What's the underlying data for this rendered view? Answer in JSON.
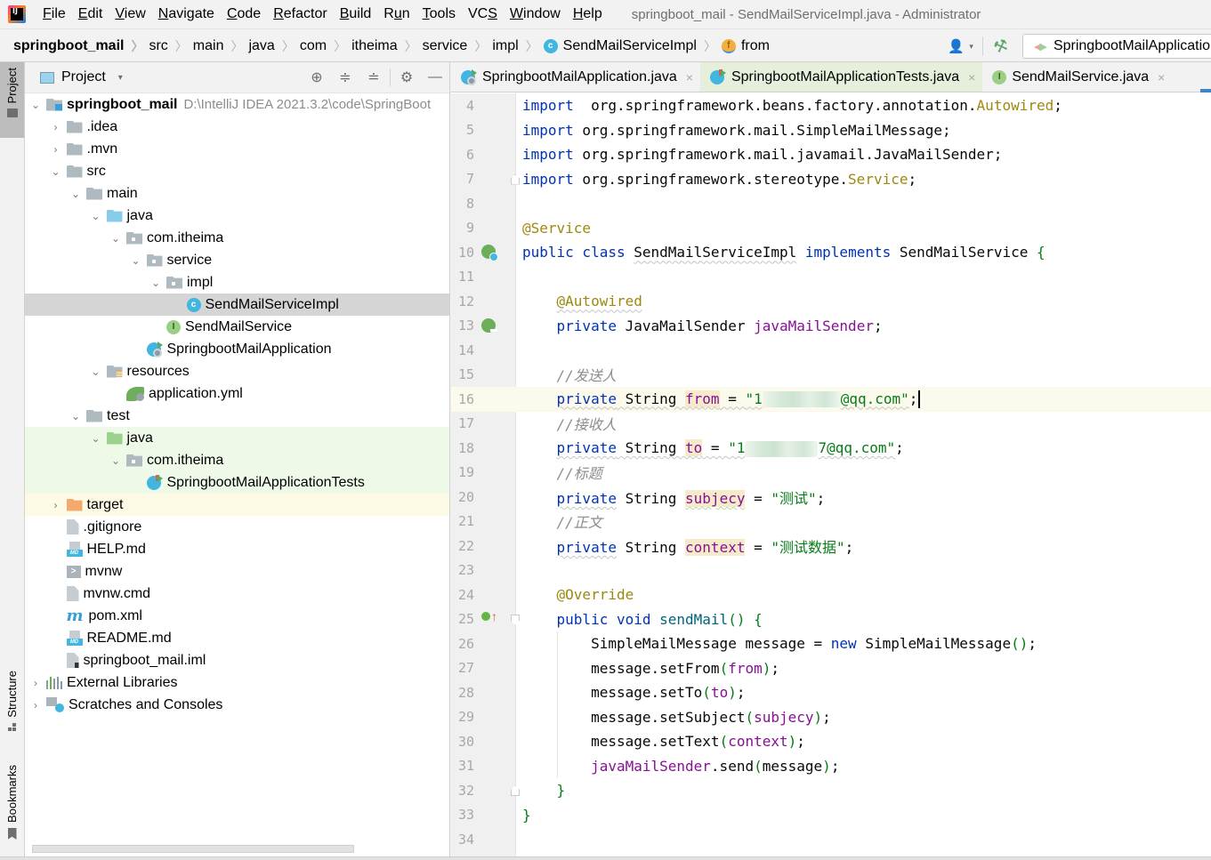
{
  "menubar": {
    "logo_text": "IJ",
    "items": [
      {
        "label": "File",
        "mnemonic": "F",
        "rest": "ile"
      },
      {
        "label": "Edit",
        "mnemonic": "E",
        "rest": "dit"
      },
      {
        "label": "View",
        "mnemonic": "V",
        "rest": "iew"
      },
      {
        "label": "Navigate",
        "mnemonic": "N",
        "rest": "avigate"
      },
      {
        "label": "Code",
        "mnemonic": "C",
        "rest": "ode"
      },
      {
        "label": "Refactor",
        "mnemonic": "R",
        "rest": "efactor"
      },
      {
        "label": "Build",
        "mnemonic": "B",
        "rest": "uild"
      },
      {
        "label": "Run",
        "pre": "R",
        "mnemonic": "u",
        "rest": "n"
      },
      {
        "label": "Tools",
        "mnemonic": "T",
        "rest": "ools"
      },
      {
        "label": "VCS",
        "pre": "VC",
        "mnemonic": "S",
        "rest": ""
      },
      {
        "label": "Window",
        "mnemonic": "W",
        "rest": "indow"
      },
      {
        "label": "Help",
        "mnemonic": "H",
        "rest": "elp"
      }
    ],
    "window_title": "springboot_mail - SendMailServiceImpl.java - Administrator"
  },
  "breadcrumb": {
    "items": [
      "springboot_mail",
      "src",
      "main",
      "java",
      "com",
      "itheima",
      "service",
      "impl",
      "SendMailServiceImpl",
      "from"
    ],
    "class_icon_glyph": "c",
    "field_icon_glyph": "f",
    "separator": "〉"
  },
  "navbar": {
    "vcs_user_icon": "👤",
    "caret": "▾",
    "build_icon": "⚒",
    "run_config_label": "SpringbootMailApplication"
  },
  "toolstrip": {
    "project_label": "Project",
    "structure_label": "Structure",
    "bookmarks_label": "Bookmarks"
  },
  "project_panel": {
    "title": "Project",
    "caret": "▾",
    "tools": {
      "locate": "⊕",
      "expand_all": "≑",
      "collapse_all": "≐",
      "settings": "⚙",
      "hide": "—"
    },
    "tree": [
      {
        "label": "springboot_mail",
        "path": "D:\\IntelliJ IDEA 2021.3.2\\code\\SpringBoot",
        "twisty": "⌄",
        "depth": 0,
        "icon": "module",
        "bold": true
      },
      {
        "label": ".idea",
        "twisty": "›",
        "depth": 1,
        "icon": "folder"
      },
      {
        "label": ".mvn",
        "twisty": "›",
        "depth": 1,
        "icon": "folder"
      },
      {
        "label": "src",
        "twisty": "⌄",
        "depth": 1,
        "icon": "folder"
      },
      {
        "label": "main",
        "twisty": "⌄",
        "depth": 2,
        "icon": "folder"
      },
      {
        "label": "java",
        "twisty": "⌄",
        "depth": 3,
        "icon": "folder-blue"
      },
      {
        "label": "com.itheima",
        "twisty": "⌄",
        "depth": 4,
        "icon": "package"
      },
      {
        "label": "service",
        "twisty": "⌄",
        "depth": 5,
        "icon": "package"
      },
      {
        "label": "impl",
        "twisty": "⌄",
        "depth": 6,
        "icon": "package"
      },
      {
        "label": "SendMailServiceImpl",
        "twisty": "",
        "depth": 7,
        "icon": "class",
        "selected": true
      },
      {
        "label": "SendMailService",
        "twisty": "",
        "depth": 6,
        "icon": "interface"
      },
      {
        "label": "SpringbootMailApplication",
        "twisty": "",
        "depth": 5,
        "icon": "boot"
      },
      {
        "label": "resources",
        "twisty": "⌄",
        "depth": 3,
        "icon": "resources"
      },
      {
        "label": "application.yml",
        "twisty": "",
        "depth": 4,
        "icon": "yml"
      },
      {
        "label": "test",
        "twisty": "⌄",
        "depth": 2,
        "icon": "folder"
      },
      {
        "label": "java",
        "twisty": "⌄",
        "depth": 3,
        "icon": "folder-green",
        "bg": "test"
      },
      {
        "label": "com.itheima",
        "twisty": "⌄",
        "depth": 4,
        "icon": "package",
        "bg": "test"
      },
      {
        "label": "SpringbootMailApplicationTests",
        "twisty": "",
        "depth": 5,
        "icon": "test",
        "bg": "test"
      },
      {
        "label": "target",
        "twisty": "›",
        "depth": 1,
        "icon": "folder-orange",
        "bg": "excluded"
      },
      {
        "label": ".gitignore",
        "twisty": "",
        "depth": 1,
        "icon": "file"
      },
      {
        "label": "HELP.md",
        "twisty": "",
        "depth": 1,
        "icon": "md"
      },
      {
        "label": "mvnw",
        "twisty": "",
        "depth": 1,
        "icon": "terminal"
      },
      {
        "label": "mvnw.cmd",
        "twisty": "",
        "depth": 1,
        "icon": "file"
      },
      {
        "label": "pom.xml",
        "twisty": "",
        "depth": 1,
        "icon": "maven"
      },
      {
        "label": "README.md",
        "twisty": "",
        "depth": 1,
        "icon": "md"
      },
      {
        "label": "springboot_mail.iml",
        "twisty": "",
        "depth": 1,
        "icon": "iml"
      },
      {
        "label": "External Libraries",
        "twisty": "›",
        "depth": 0,
        "icon": "libraries"
      },
      {
        "label": "Scratches and Consoles",
        "twisty": "›",
        "depth": 0,
        "icon": "scratches"
      }
    ]
  },
  "editor": {
    "tabs": [
      {
        "label": "SpringbootMailApplication.java",
        "icon": "boot",
        "close": "×"
      },
      {
        "label": "SpringbootMailApplicationTests.java",
        "icon": "test",
        "close": "×"
      },
      {
        "label": "SendMailService.java",
        "icon": "interface",
        "close": "×"
      }
    ],
    "current_line": 16,
    "lines": [
      {
        "n": "4",
        "tokens": [
          [
            "kw",
            "import"
          ],
          [
            "",
            "  org.springframework.beans.factory.annotation."
          ],
          [
            "ann",
            "Autowired"
          ],
          [
            "",
            ";"
          ]
        ]
      },
      {
        "n": "5",
        "tokens": [
          [
            "kw",
            "import"
          ],
          [
            "",
            " org.springframework.mail.SimpleMailMessage;"
          ]
        ]
      },
      {
        "n": "6",
        "tokens": [
          [
            "kw",
            "import"
          ],
          [
            "",
            " org.springframework.mail.javamail.JavaMailSender;"
          ]
        ]
      },
      {
        "n": "7",
        "tokens": [
          [
            "kw",
            "import"
          ],
          [
            "",
            " org.springframework.stereotype."
          ],
          [
            "ann",
            "Service"
          ],
          [
            "",
            ";"
          ]
        ]
      },
      {
        "n": "8",
        "tokens": []
      },
      {
        "n": "9",
        "tokens": [
          [
            "ann",
            "@Service"
          ]
        ]
      },
      {
        "n": "10",
        "tokens": [
          [
            "kw",
            "public class "
          ],
          [
            "squig",
            "SendMailServiceImpl"
          ],
          [
            "kw",
            " implements "
          ],
          [
            "",
            "SendMailService "
          ],
          [
            "paren",
            "{"
          ]
        ]
      },
      {
        "n": "11",
        "tokens": []
      },
      {
        "n": "12",
        "tokens": [
          [
            "",
            "    "
          ],
          [
            "ann squig",
            "@Autowired"
          ]
        ]
      },
      {
        "n": "13",
        "tokens": [
          [
            "",
            "    "
          ],
          [
            "kw",
            "private "
          ],
          [
            "",
            "JavaMailSender "
          ],
          [
            "fld",
            "javaMailSender"
          ],
          [
            "",
            ";"
          ]
        ]
      },
      {
        "n": "14",
        "tokens": []
      },
      {
        "n": "15",
        "tokens": [
          [
            "",
            "    "
          ],
          [
            "cmt",
            "//发送人"
          ]
        ]
      },
      {
        "n": "16",
        "tokens": [
          [
            "",
            "    "
          ],
          [
            "kw squig",
            "private"
          ],
          [
            "squig",
            " String "
          ],
          [
            "fld hl-word squig",
            "from"
          ],
          [
            "squig",
            " = "
          ],
          [
            "str squig",
            "\"1"
          ],
          [
            "blur",
            ""
          ],
          [
            "str squig",
            "@qq.com\""
          ],
          [
            "",
            ";"
          ],
          [
            "caret",
            ""
          ]
        ]
      },
      {
        "n": "17",
        "tokens": [
          [
            "",
            "    "
          ],
          [
            "cmt",
            "//接收人"
          ]
        ]
      },
      {
        "n": "18",
        "tokens": [
          [
            "",
            "    "
          ],
          [
            "kw squig",
            "private"
          ],
          [
            "squig",
            " String "
          ],
          [
            "fld hl-word squig",
            "to"
          ],
          [
            "squig",
            " = "
          ],
          [
            "str squig",
            "\"1"
          ],
          [
            "blur to",
            ""
          ],
          [
            "str squig",
            "7@qq.com\""
          ],
          [
            "",
            ";"
          ]
        ]
      },
      {
        "n": "19",
        "tokens": [
          [
            "",
            "    "
          ],
          [
            "cmt",
            "//标题"
          ]
        ]
      },
      {
        "n": "20",
        "tokens": [
          [
            "",
            "    "
          ],
          [
            "kw squig",
            "private"
          ],
          [
            "",
            " String "
          ],
          [
            "fld hl-word squig-g",
            "subjecy"
          ],
          [
            "",
            " = "
          ],
          [
            "str",
            "\"测试\""
          ],
          [
            "",
            ";"
          ]
        ]
      },
      {
        "n": "21",
        "tokens": [
          [
            "",
            "    "
          ],
          [
            "cmt",
            "//正文"
          ]
        ]
      },
      {
        "n": "22",
        "tokens": [
          [
            "",
            "    "
          ],
          [
            "kw squig",
            "private"
          ],
          [
            "",
            " String "
          ],
          [
            "fld hl-word",
            "context"
          ],
          [
            "",
            " = "
          ],
          [
            "str",
            "\"测试数据\""
          ],
          [
            "",
            ";"
          ]
        ]
      },
      {
        "n": "23",
        "tokens": []
      },
      {
        "n": "24",
        "tokens": [
          [
            "",
            "    "
          ],
          [
            "ann",
            "@Override"
          ]
        ]
      },
      {
        "n": "25",
        "tokens": [
          [
            "",
            "    "
          ],
          [
            "kw",
            "public void "
          ],
          [
            "fn",
            "sendMail"
          ],
          [
            "paren",
            "() {"
          ]
        ]
      },
      {
        "n": "26",
        "tokens": [
          [
            "",
            "        SimpleMailMessage message = "
          ],
          [
            "kw",
            "new "
          ],
          [
            "",
            "SimpleMailMessage"
          ],
          [
            "paren",
            "()"
          ],
          [
            "",
            ";"
          ]
        ]
      },
      {
        "n": "27",
        "tokens": [
          [
            "",
            "        message.setFrom"
          ],
          [
            "paren",
            "("
          ],
          [
            "fld",
            "from"
          ],
          [
            "paren",
            ")"
          ],
          [
            "",
            ";"
          ]
        ]
      },
      {
        "n": "28",
        "tokens": [
          [
            "",
            "        message.setTo"
          ],
          [
            "paren",
            "("
          ],
          [
            "fld",
            "to"
          ],
          [
            "paren",
            ")"
          ],
          [
            "",
            ";"
          ]
        ]
      },
      {
        "n": "29",
        "tokens": [
          [
            "",
            "        message.setSubject"
          ],
          [
            "paren",
            "("
          ],
          [
            "fld",
            "subjecy"
          ],
          [
            "paren",
            ")"
          ],
          [
            "",
            ";"
          ]
        ]
      },
      {
        "n": "30",
        "tokens": [
          [
            "",
            "        message.setText"
          ],
          [
            "paren",
            "("
          ],
          [
            "fld",
            "context"
          ],
          [
            "paren",
            ")"
          ],
          [
            "",
            ";"
          ]
        ]
      },
      {
        "n": "31",
        "tokens": [
          [
            "",
            "        "
          ],
          [
            "fld",
            "javaMailSender"
          ],
          [
            "",
            ".send"
          ],
          [
            "paren",
            "("
          ],
          [
            "",
            "message"
          ],
          [
            "paren",
            ")"
          ],
          [
            "",
            ";"
          ]
        ]
      },
      {
        "n": "32",
        "tokens": [
          [
            "",
            "    "
          ],
          [
            "paren",
            "}"
          ]
        ]
      },
      {
        "n": "33",
        "tokens": [
          [
            "paren",
            "}"
          ]
        ]
      },
      {
        "n": "34",
        "tokens": []
      }
    ],
    "gutter_icons": {
      "10": "bean-class",
      "13": "bean-autowired",
      "25": "implements-method"
    },
    "fold_markers": {
      "7": "end",
      "25": "start",
      "32": "end"
    }
  }
}
